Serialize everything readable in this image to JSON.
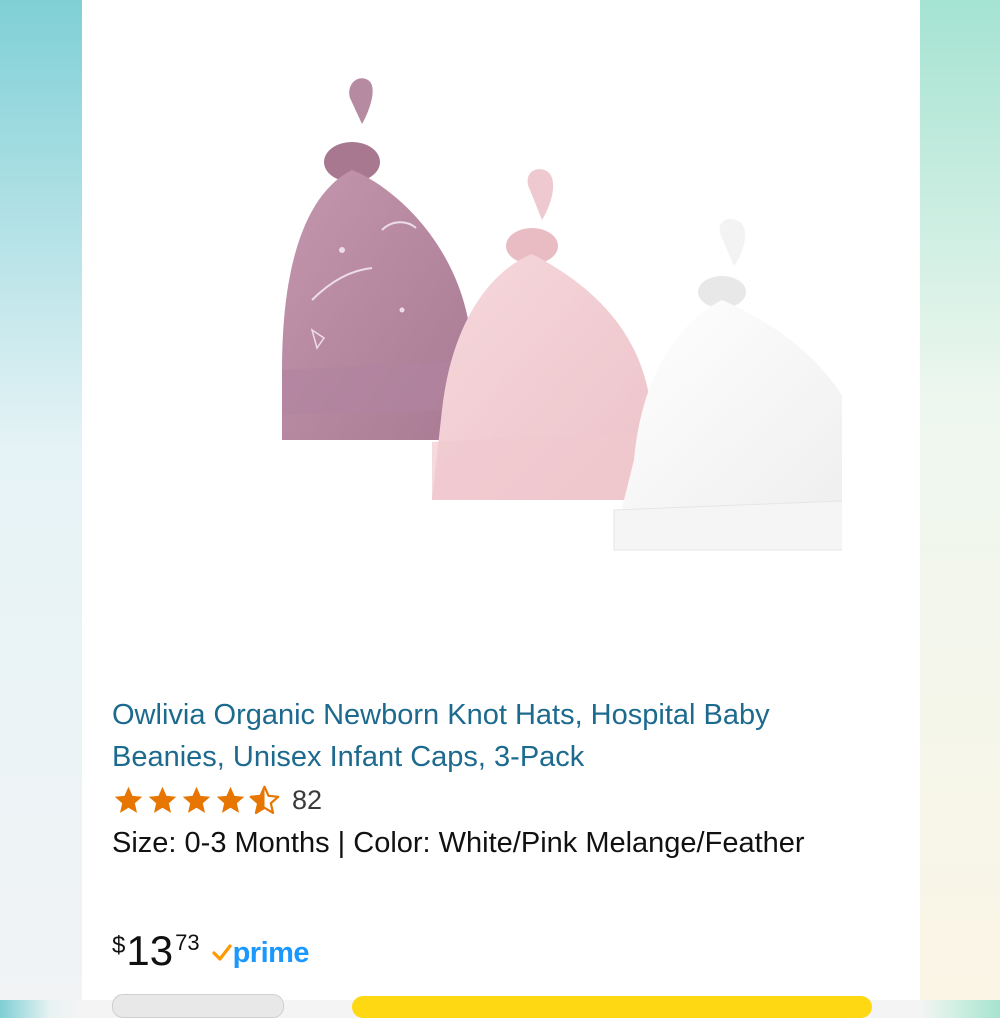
{
  "product": {
    "title": "Owlivia Organic Newborn Knot Hats, Hospital Baby Beanies, Unisex Infant Caps, 3-Pack",
    "rating": 4.5,
    "rating_count": "82",
    "variant": "Size: 0-3 Months | Color: White/Pink Melange/Feather",
    "price": {
      "symbol": "$",
      "whole": "13",
      "fraction": "73"
    },
    "prime_label": "prime",
    "image_icon": "knot-hats-image"
  },
  "colors": {
    "title_link": "#1d6a8f",
    "star": "#e77600",
    "prime": "#1a98ff",
    "prime_check": "#ff9900",
    "hat_purple": "#b98aa3",
    "hat_pink": "#f2ced4",
    "hat_white": "#fbfbfb"
  }
}
